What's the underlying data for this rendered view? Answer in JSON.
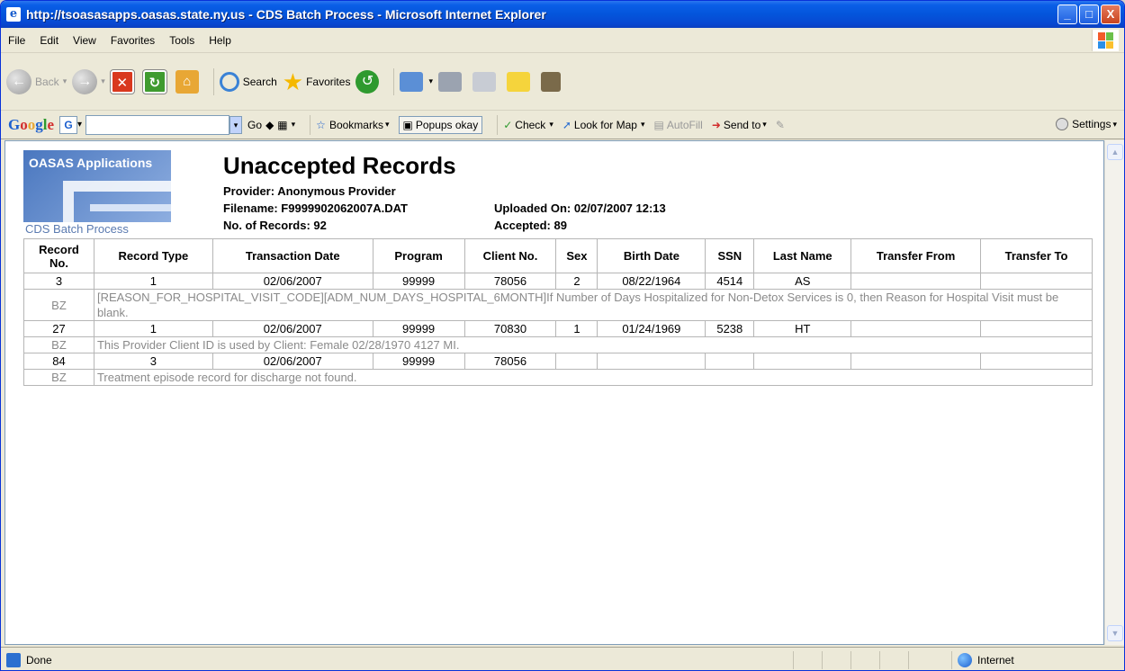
{
  "window": {
    "title": "http://tsoasasapps.oasas.state.ny.us - CDS Batch Process - Microsoft Internet Explorer",
    "buttons": {
      "minimize": "_",
      "maximize": "□",
      "close": "X"
    }
  },
  "menu": [
    "File",
    "Edit",
    "View",
    "Favorites",
    "Tools",
    "Help"
  ],
  "toolbar": {
    "back": "Back",
    "search": "Search",
    "favorites": "Favorites"
  },
  "google": {
    "go": "Go",
    "bookmarks": "Bookmarks",
    "popups": "Popups okay",
    "check": "Check",
    "look_for_map": "Look for Map",
    "autofill": "AutoFill",
    "send_to": "Send to",
    "settings": "Settings"
  },
  "page": {
    "logo_title": "OASAS Applications",
    "logo_caption": "CDS Batch Process",
    "title": "Unaccepted Records",
    "provider": "Provider: Anonymous Provider",
    "filename": "Filename: F9999902062007A.DAT",
    "records": "No. of Records: 92",
    "uploaded": "Uploaded On: 02/07/2007 12:13",
    "accepted": "Accepted: 89"
  },
  "table": {
    "headers": [
      "Record No.",
      "Record Type",
      "Transaction Date",
      "Program",
      "Client No.",
      "Sex",
      "Birth Date",
      "SSN",
      "Last Name",
      "Transfer From",
      "Transfer To"
    ],
    "rows": [
      {
        "cells": [
          "3",
          "1",
          "02/06/2007",
          "99999",
          "78056",
          "2",
          "08/22/1964",
          "4514",
          "AS",
          "",
          ""
        ],
        "err_code": "BZ",
        "err_msg": "[REASON_FOR_HOSPITAL_VISIT_CODE][ADM_NUM_DAYS_HOSPITAL_6MONTH]If Number of Days Hospitalized for Non-Detox Services is 0, then Reason for Hospital Visit must be blank."
      },
      {
        "cells": [
          "27",
          "1",
          "02/06/2007",
          "99999",
          "70830",
          "1",
          "01/24/1969",
          "5238",
          "HT",
          "",
          ""
        ],
        "err_code": "BZ",
        "err_msg": "This Provider Client ID is used by Client: Female 02/28/1970 4127 MI."
      },
      {
        "cells": [
          "84",
          "3",
          "02/06/2007",
          "99999",
          "78056",
          "",
          "",
          "",
          "",
          "",
          ""
        ],
        "err_code": "BZ",
        "err_msg": "Treatment episode record for discharge not found."
      }
    ]
  },
  "status": {
    "text": "Done",
    "zone": "Internet"
  }
}
